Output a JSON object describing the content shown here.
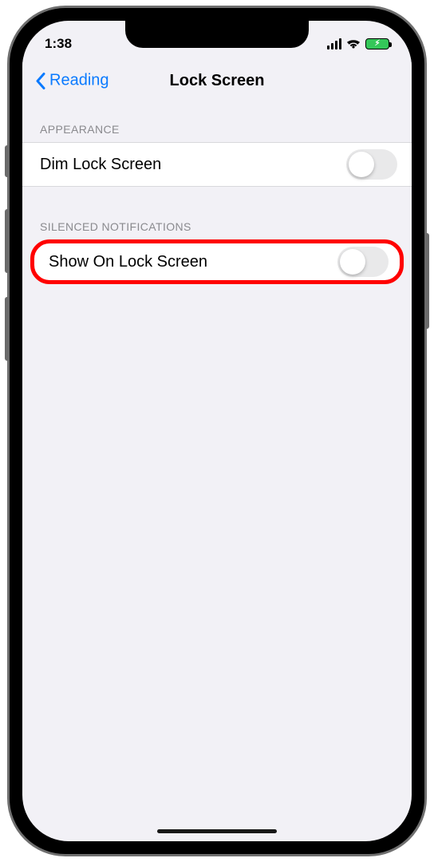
{
  "statusbar": {
    "time": "1:38"
  },
  "nav": {
    "back_label": "Reading",
    "title": "Lock Screen"
  },
  "sections": {
    "appearance": {
      "header": "APPEARANCE",
      "dim_label": "Dim Lock Screen",
      "dim_on": false
    },
    "silenced": {
      "header": "SILENCED NOTIFICATIONS",
      "show_label": "Show On Lock Screen",
      "show_on": false
    }
  }
}
